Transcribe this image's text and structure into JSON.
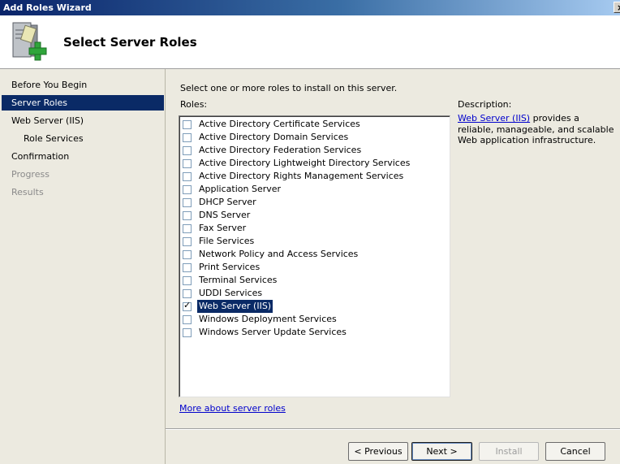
{
  "window": {
    "title": "Add Roles Wizard",
    "close_glyph": "×"
  },
  "header": {
    "title": "Select Server Roles",
    "icon": "server-add-icon"
  },
  "sidebar": {
    "items": [
      {
        "label": "Before You Begin",
        "state": "normal"
      },
      {
        "label": "Server Roles",
        "state": "active"
      },
      {
        "label": "Web Server (IIS)",
        "state": "normal"
      },
      {
        "label": "Role Services",
        "state": "normal"
      },
      {
        "label": "Confirmation",
        "state": "normal"
      },
      {
        "label": "Progress",
        "state": "disabled"
      },
      {
        "label": "Results",
        "state": "disabled"
      }
    ]
  },
  "main": {
    "instruction": "Select one or more roles to install on this server.",
    "roles_label": "Roles:",
    "roles": [
      {
        "label": "Active Directory Certificate Services",
        "checked": false
      },
      {
        "label": "Active Directory Domain Services",
        "checked": false
      },
      {
        "label": "Active Directory Federation Services",
        "checked": false
      },
      {
        "label": "Active Directory Lightweight Directory Services",
        "checked": false
      },
      {
        "label": "Active Directory Rights Management Services",
        "checked": false
      },
      {
        "label": "Application Server",
        "checked": false
      },
      {
        "label": "DHCP Server",
        "checked": false
      },
      {
        "label": "DNS Server",
        "checked": false
      },
      {
        "label": "Fax Server",
        "checked": false
      },
      {
        "label": "File Services",
        "checked": false
      },
      {
        "label": "Network Policy and Access Services",
        "checked": false
      },
      {
        "label": "Print Services",
        "checked": false
      },
      {
        "label": "Terminal Services",
        "checked": false
      },
      {
        "label": "UDDI Services",
        "checked": false
      },
      {
        "label": "Web Server (IIS)",
        "checked": true,
        "selected": true
      },
      {
        "label": "Windows Deployment Services",
        "checked": false
      },
      {
        "label": "Windows Server Update Services",
        "checked": false
      }
    ],
    "description_label": "Description:",
    "description_link": "Web Server (IIS)",
    "description_text": " provides a reliable, manageable, and scalable Web application infrastructure.",
    "more_link": "More about server roles"
  },
  "buttons": {
    "previous": "< Previous",
    "next": "Next >",
    "install": "Install",
    "cancel": "Cancel"
  },
  "colors": {
    "selection": "#0a2a66",
    "sidebar_bg": "#eceae0",
    "link": "#0000cc"
  }
}
